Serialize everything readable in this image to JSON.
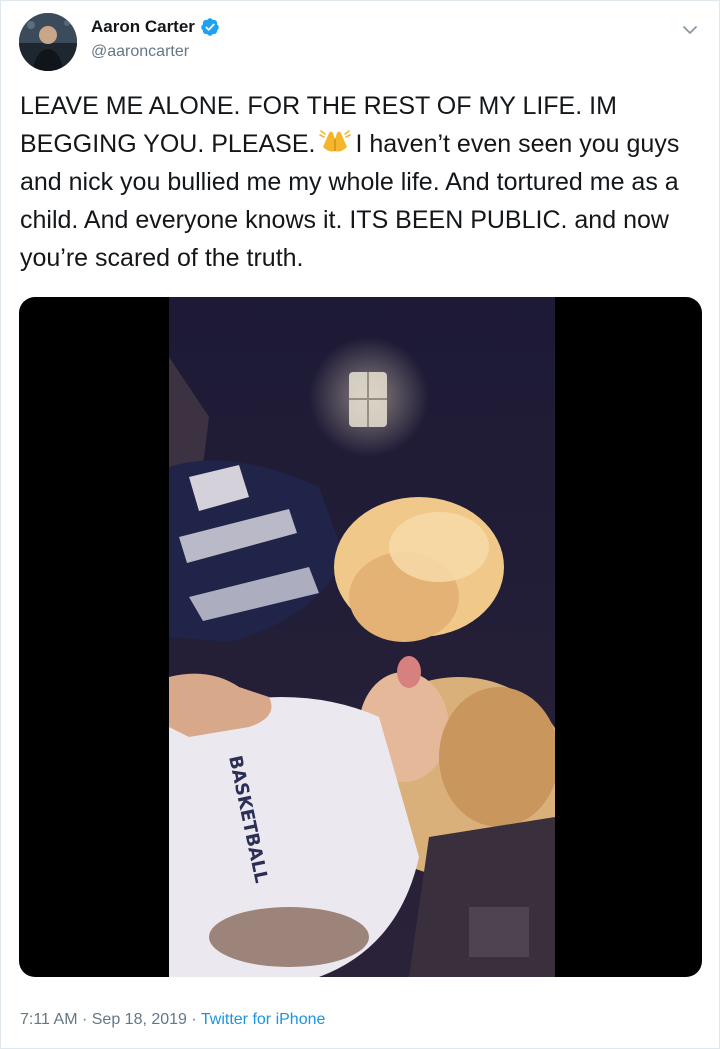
{
  "user": {
    "display_name": "Aaron Carter",
    "handle": "@aaroncarter",
    "verified": true
  },
  "tweet": {
    "text_before_emoji": "LEAVE ME ALONE. FOR THE REST OF MY LIFE. IM BEGGING YOU. PLEASE.",
    "emoji": "folded-hands",
    "text_after_emoji": "I haven’t even seen you guys and nick you bullied me my whole life. And tortured me as a child. And everyone knows it. ITS BEEN PUBLIC. and now you’re scared of the truth."
  },
  "media": {
    "type": "video",
    "shirt_text": "BASKETBALL"
  },
  "footer": {
    "time": "7:11 AM",
    "separator": "·",
    "date": "Sep 18, 2019",
    "source": "Twitter for iPhone"
  },
  "colors": {
    "link": "#1b95e0",
    "verified_badge": "#1da1f2",
    "secondary_text": "#657786",
    "primary_text": "#14171a"
  }
}
